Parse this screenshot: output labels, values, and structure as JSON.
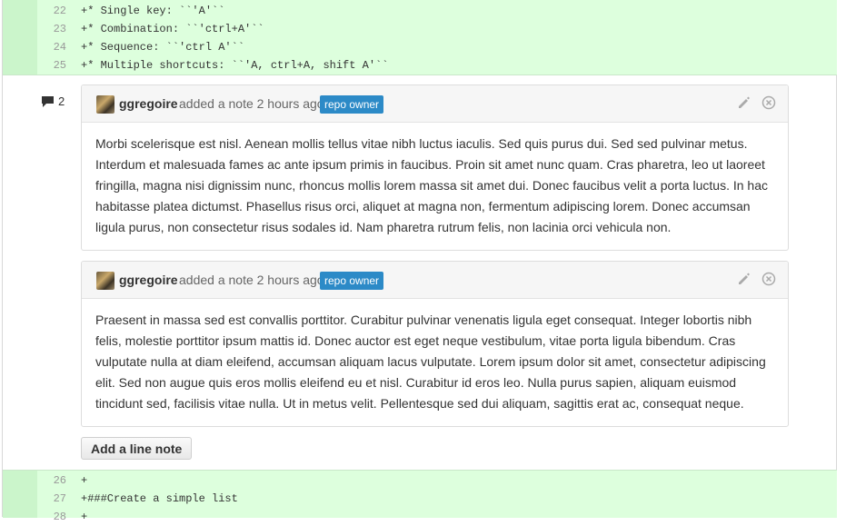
{
  "diff_top": {
    "lines": [
      {
        "num": "22",
        "code": "+* Single key: ``'A'``"
      },
      {
        "num": "23",
        "code": "+* Combination: ``'ctrl+A'``"
      },
      {
        "num": "24",
        "code": "+* Sequence: ``'ctrl A'``"
      },
      {
        "num": "25",
        "code": "+* Multiple shortcuts: ``'A, ctrl+A, shift A'``"
      }
    ]
  },
  "comment_count": "2",
  "notes": [
    {
      "author": "ggregoire",
      "action": "added a note 2 hours ago",
      "badge": "repo owner",
      "body": "Morbi scelerisque est nisl. Aenean mollis tellus vitae nibh luctus iaculis. Sed quis purus dui. Sed sed pulvinar metus. Interdum et malesuada fames ac ante ipsum primis in faucibus. Proin sit amet nunc quam. Cras pharetra, leo ut laoreet fringilla, magna nisi dignissim nunc, rhoncus mollis lorem massa sit amet dui. Donec faucibus velit a porta luctus. In hac habitasse platea dictumst. Phasellus risus orci, aliquet at magna non, fermentum adipiscing lorem. Donec accumsan ligula purus, non consectetur risus sodales id. Nam pharetra rutrum felis, non lacinia orci vehicula non."
    },
    {
      "author": "ggregoire",
      "action": "added a note 2 hours ago",
      "badge": "repo owner",
      "body": "Praesent in massa sed est convallis porttitor. Curabitur pulvinar venenatis ligula eget consequat. Integer lobortis nibh felis, molestie porttitor ipsum mattis id. Donec auctor est eget neque vestibulum, vitae porta ligula bibendum. Cras vulputate nulla at diam eleifend, accumsan aliquam lacus vulputate. Lorem ipsum dolor sit amet, consectetur adipiscing elit. Sed non augue quis eros mollis eleifend eu et nisl. Curabitur id eros leo. Nulla purus sapien, aliquam euismod tincidunt sed, facilisis vitae nulla. Ut in metus velit. Pellentesque sed dui aliquam, sagittis erat ac, consequat neque."
    }
  ],
  "add_line_note_label": "Add a line note",
  "diff_bottom": {
    "lines": [
      {
        "num": "26",
        "code": "+"
      },
      {
        "num": "27",
        "code": "+###Create a simple list"
      },
      {
        "num": "28",
        "code": "+"
      }
    ]
  },
  "icons": {
    "comment": "comment-icon",
    "edit": "pencil-icon",
    "delete": "close-circle-icon",
    "avatar": "user-avatar"
  },
  "colors": {
    "diff_added_bg": "#ddffdd",
    "badge_bg": "#2c8ac7"
  }
}
